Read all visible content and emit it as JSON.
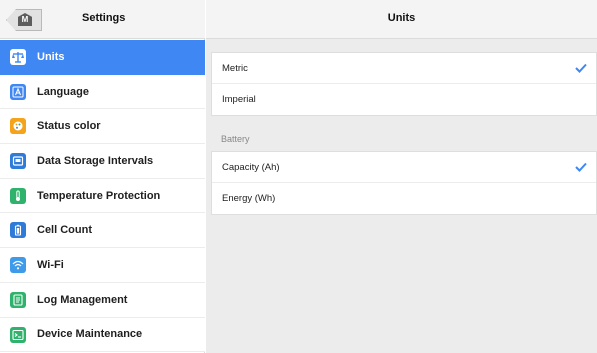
{
  "sidebar": {
    "title": "Settings",
    "home_glyph": "M",
    "items": [
      {
        "label": "Units",
        "icon": "scale-icon",
        "color": "#3f87f3",
        "glyph": "⚖",
        "active": true
      },
      {
        "label": "Language",
        "icon": "language-icon",
        "color": "#3f87f3",
        "glyph": "A",
        "active": false
      },
      {
        "label": "Status color",
        "icon": "palette-icon",
        "color": "#f5a31a",
        "glyph": "●",
        "active": false
      },
      {
        "label": "Data Storage Intervals",
        "icon": "storage-icon",
        "color": "#2e7bd8",
        "glyph": "▣",
        "active": false
      },
      {
        "label": "Temperature Protection",
        "icon": "thermometer-icon",
        "color": "#2fb26b",
        "glyph": "🌡",
        "active": false
      },
      {
        "label": "Cell Count",
        "icon": "battery-icon",
        "color": "#2e7bd8",
        "glyph": "▮",
        "active": false
      },
      {
        "label": "Wi-Fi",
        "icon": "wifi-icon",
        "color": "#3f9be9",
        "glyph": "≋",
        "active": false
      },
      {
        "label": "Log Management",
        "icon": "log-icon",
        "color": "#2fb26b",
        "glyph": "≡",
        "active": false
      },
      {
        "label": "Device Maintenance",
        "icon": "terminal-icon",
        "color": "#2fb26b",
        "glyph": ">_",
        "active": false
      }
    ]
  },
  "main": {
    "title": "Units",
    "units_options": [
      {
        "label": "Metric",
        "selected": true
      },
      {
        "label": "Imperial",
        "selected": false
      }
    ],
    "battery_section_title": "Battery",
    "battery_options": [
      {
        "label": "Capacity (Ah)",
        "selected": true
      },
      {
        "label": "Energy (Wh)",
        "selected": false
      }
    ]
  },
  "colors": {
    "accent": "#3f87f3",
    "check": "#3f87f3"
  }
}
